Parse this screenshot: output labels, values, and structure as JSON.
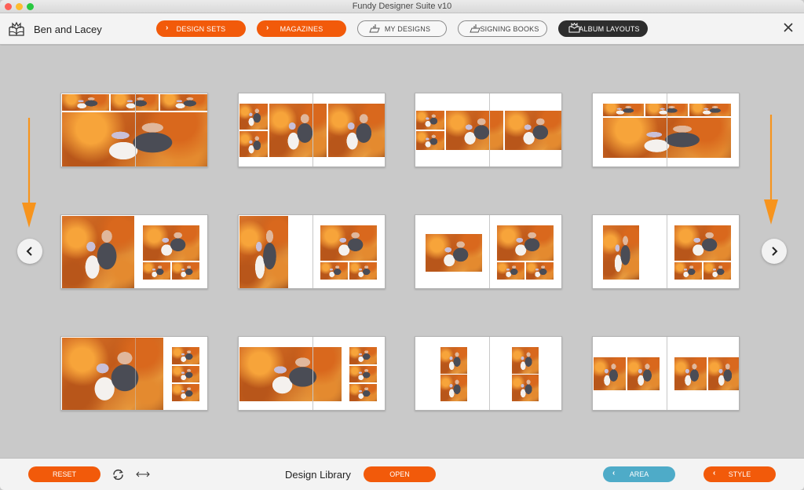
{
  "window": {
    "title": "Fundy Designer Suite v10"
  },
  "toolbar": {
    "project_name": "Ben and Lacey",
    "buttons": [
      {
        "label": "DESIGN SETS",
        "style": "orange",
        "icon": "chevron-right-icon"
      },
      {
        "label": "MAGAZINES",
        "style": "orange",
        "icon": "chevron-right-icon"
      },
      {
        "label": "MY DESIGNS",
        "style": "outline",
        "icon": "design-hand-icon"
      },
      {
        "label": "SIGNING BOOKS",
        "style": "outline",
        "icon": "design-hand-icon"
      },
      {
        "label": "ALBUM LAYOUTS",
        "style": "dark",
        "icon": "album-icon",
        "active": true
      }
    ],
    "close_icon": "close-icon"
  },
  "library": {
    "layouts": [
      {
        "id": 1,
        "description": "3 small top strip + full-spread panorama"
      },
      {
        "id": 2,
        "description": "2 stacked small + 2 large across spread"
      },
      {
        "id": 3,
        "description": "2 stacked small + 2 large centered band"
      },
      {
        "id": 4,
        "description": "3 small strip + large panorama inset"
      },
      {
        "id": 5,
        "description": "full-bleed left page + 1 large 2 small right"
      },
      {
        "id": 6,
        "description": "large left portrait + 1 large 2 small right"
      },
      {
        "id": 7,
        "description": "single inset left + 1 large 2 small right"
      },
      {
        "id": 8,
        "description": "portrait inset left + 1 large 2 small right"
      },
      {
        "id": 9,
        "description": "wide panorama + 3 stacked right"
      },
      {
        "id": 10,
        "description": "band panorama + 3 stacked right"
      },
      {
        "id": 11,
        "description": "2 stacked each page"
      },
      {
        "id": 12,
        "description": "2 side-by-side each page"
      }
    ],
    "prev_icon": "chevron-left-icon",
    "next_icon": "chevron-right-icon",
    "annotation_color": "#f7941d"
  },
  "bottombar": {
    "reset_label": "RESET",
    "title": "Design Library",
    "open_label": "OPEN",
    "area_label": "AREA",
    "style_label": "STYLE"
  },
  "colors": {
    "accent_orange": "#f25a0a",
    "accent_blue": "#4eabc8",
    "active_dark": "#2d2d2d"
  }
}
